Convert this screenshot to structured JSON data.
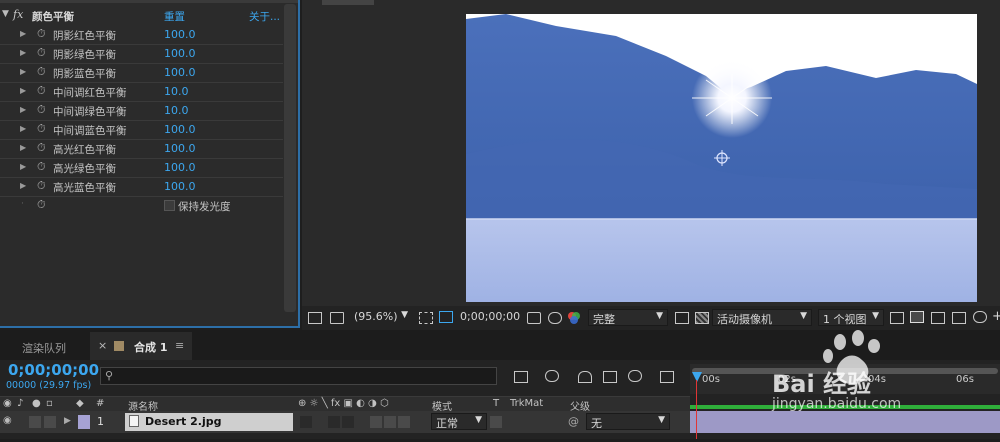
{
  "effect_panel": {
    "effect_name": "颜色平衡",
    "fx_label": "fx",
    "reset": "重置",
    "about": "关于...",
    "params": [
      {
        "name": "阴影红色平衡",
        "value": "100.0"
      },
      {
        "name": "阴影绿色平衡",
        "value": "100.0"
      },
      {
        "name": "阴影蓝色平衡",
        "value": "100.0"
      },
      {
        "name": "中间调红色平衡",
        "value": "10.0"
      },
      {
        "name": "中间调绿色平衡",
        "value": "10.0"
      },
      {
        "name": "中间调蓝色平衡",
        "value": "100.0"
      },
      {
        "name": "高光红色平衡",
        "value": "100.0"
      },
      {
        "name": "高光绿色平衡",
        "value": "100.0"
      },
      {
        "name": "高光蓝色平衡",
        "value": "100.0"
      }
    ],
    "preserve_luminosity": "保持发光度"
  },
  "viewer": {
    "zoom": "(95.6%)",
    "timecode": "0;00;00;00",
    "resolution": "完整",
    "camera": "活动摄像机",
    "views": "1 个视图",
    "plus": "+"
  },
  "tabs": {
    "render_queue": "渲染队列",
    "close": "×",
    "comp": "合成 1",
    "menu": "≡"
  },
  "timeline": {
    "timecode": "0;00;00;00",
    "frames": "00000 (29.97 fps)",
    "search_placeholder": "",
    "headers": {
      "num": "#",
      "source": "源名称",
      "mode": "模式",
      "t": "T",
      "trkmat": "TrkMat",
      "parent": "父级"
    },
    "ruler": [
      "00s",
      "02s",
      "04s",
      "06s"
    ],
    "layer": {
      "index": "1",
      "name": "Desert 2.jpg",
      "mode": "正常",
      "parent": "无"
    }
  },
  "watermark": {
    "brand": "Bai 经验",
    "url": "jingyan.baidu.com"
  },
  "colors": {
    "accent": "#3ca7ef",
    "panel_border": "#2d6fa8",
    "image_blue": "#4a72b8"
  }
}
